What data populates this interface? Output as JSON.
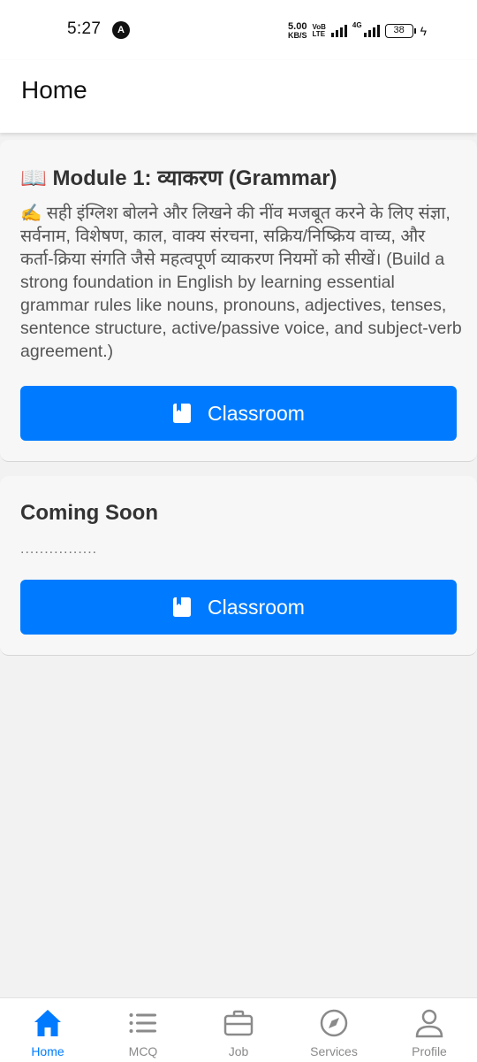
{
  "status_bar": {
    "time": "5:27",
    "notification_badge": "A",
    "speed_value": "5.00",
    "speed_unit": "KB/S",
    "volte_top": "VoB",
    "volte_bottom": "LTE",
    "network_type": "4G",
    "battery": "38"
  },
  "header": {
    "title": "Home"
  },
  "cards": [
    {
      "title": "📖 Module 1: व्याकरण (Grammar)",
      "description": "✍️ सही इंग्लिश बोलने और लिखने की नींव मजबूत करने के लिए संज्ञा, सर्वनाम, विशेषण, काल, वाक्य संरचना, सक्रिय/निष्क्रिय वाच्य, और कर्ता-क्रिया संगति जैसे महत्वपूर्ण व्याकरण नियमों को सीखें। (Build a strong foundation in English by learning essential grammar rules like nouns, pronouns, adjectives, tenses, sentence structure, active/passive voice, and subject-verb agreement.)",
      "button_label": "Classroom"
    },
    {
      "title": "Coming Soon",
      "description": "................",
      "button_label": "Classroom"
    }
  ],
  "bottom_nav": {
    "items": [
      {
        "label": "Home",
        "icon": "home-icon",
        "active": true
      },
      {
        "label": "MCQ",
        "icon": "list-icon",
        "active": false
      },
      {
        "label": "Job",
        "icon": "briefcase-icon",
        "active": false
      },
      {
        "label": "Services",
        "icon": "compass-icon",
        "active": false
      },
      {
        "label": "Profile",
        "icon": "person-icon",
        "active": false
      }
    ]
  },
  "colors": {
    "accent": "#007bff",
    "inactive_nav": "#8a8a8a",
    "background": "#f2f2f2",
    "card_background": "#f7f7f7"
  }
}
